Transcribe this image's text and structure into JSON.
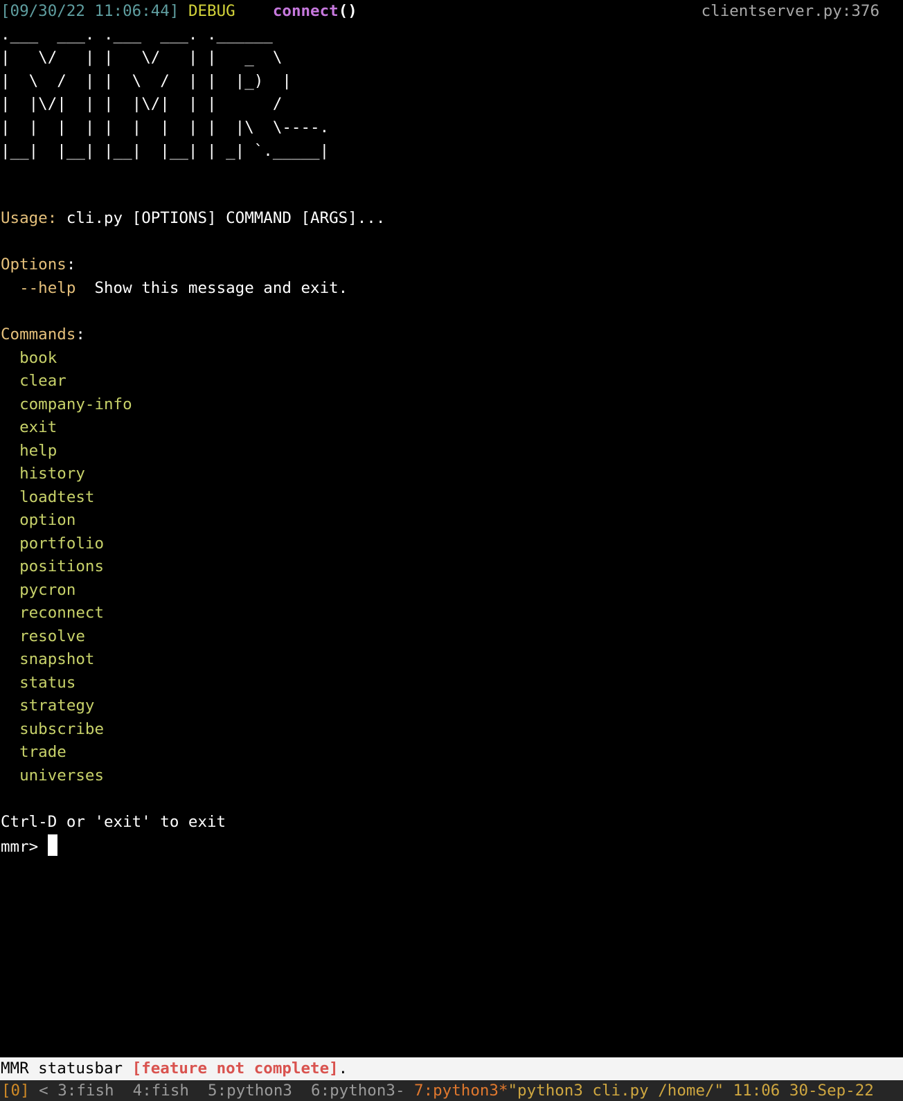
{
  "log": {
    "timestamp": "[09/30/22 11:06:44]",
    "level": "DEBUG",
    "function": "connect",
    "parens": "()",
    "source": "clientserver.py:376"
  },
  "banner": [
    ".___  ___. .___  ___. .______",
    "|   \\/   | |   \\/   | |   _  \\",
    "|  \\  /  | |  \\  /  | |  |_)  |",
    "|  |\\/|  | |  |\\/|  | |      /",
    "|  |  |  | |  |  |  | |  |\\  \\----.",
    "|__|  |__| |__|  |__| | _| `._____|"
  ],
  "usage": {
    "label": "Usage:",
    "text": " cli.py [OPTIONS] COMMAND [ARGS]..."
  },
  "options": {
    "label": "Options",
    "colon": ":",
    "flag": "--help",
    "description": "Show this message and exit."
  },
  "commands": {
    "label": "Commands",
    "colon": ":",
    "items": [
      "book",
      "clear",
      "company-info",
      "exit",
      "help",
      "history",
      "loadtest",
      "option",
      "portfolio",
      "positions",
      "pycron",
      "reconnect",
      "resolve",
      "snapshot",
      "status",
      "strategy",
      "subscribe",
      "trade",
      "universes"
    ]
  },
  "hint": "Ctrl-D or 'exit' to exit",
  "prompt": "mmr> ",
  "statusbar": {
    "text": "MMR statusbar ",
    "warning": "[feature not complete]",
    "period": "."
  },
  "tmux": {
    "session": "[0]",
    "windows": " < 3:fish  4:fish  5:python3  6:python3- ",
    "active": "7:python3*",
    "right": "\"python3 cli.py /home/\" 11:06 30-Sep-22"
  },
  "colors": {
    "background": "#000000",
    "timestamp": "#5f9ea0",
    "debug": "#d4d43a",
    "function": "#c678dd",
    "label": "#e5c07b",
    "command": "#c8d26a",
    "warning": "#d9534f",
    "statusbar_bg": "#f4f4f4",
    "tmux_bg": "#262626"
  }
}
